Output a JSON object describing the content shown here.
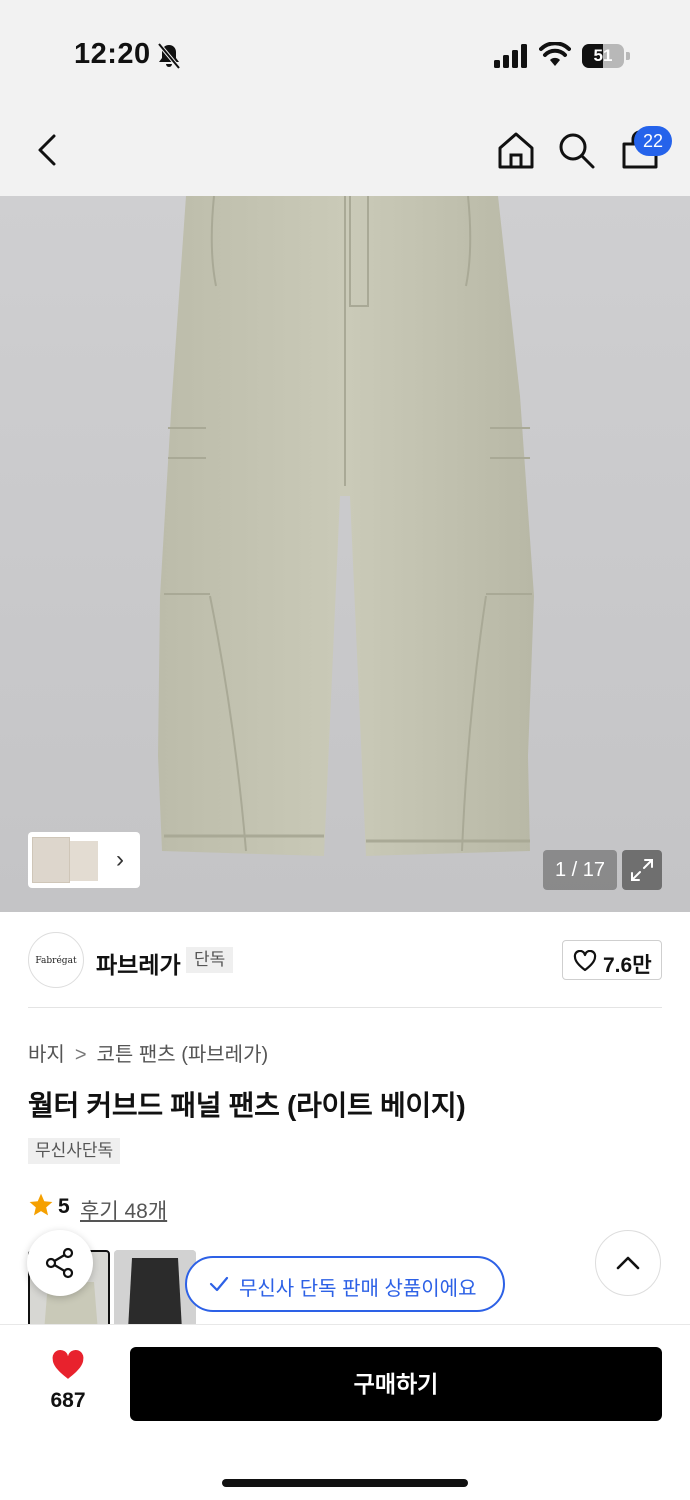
{
  "status_bar": {
    "time": "12:20",
    "battery": "51",
    "battery_level_percent": 51
  },
  "nav": {
    "back_icon": "chevron-left-icon",
    "home_icon": "home-icon",
    "search_icon": "search-icon",
    "cart_icon": "shopping-bag-icon",
    "cart_count": "22"
  },
  "gallery": {
    "counter": "1 / 17",
    "expand_icon": "expand-icon"
  },
  "brand": {
    "logo_text": "Fabrégat",
    "name": "파브레가",
    "tag": "단독",
    "likes": "7.6만"
  },
  "product": {
    "breadcrumb": [
      "바지",
      "코튼 팬츠 (파브레가)"
    ],
    "title": "월터 커브드 패널 팬츠 (라이트 베이지)",
    "exclusive_tag": "무신사단독",
    "rating": "5",
    "reviews": "후기 48개"
  },
  "floating": {
    "notice": "무신사 단독 판매 상품이에요",
    "share_icon": "share-icon",
    "scroll_top_icon": "chevron-up-icon"
  },
  "bottom_bar": {
    "like_count": "687",
    "buy_label": "구매하기"
  },
  "colors": {
    "accent_blue": "#2d61e6",
    "badge_blue": "#2563eb",
    "heart_red": "#e8222d",
    "star_orange": "#f5a000"
  }
}
